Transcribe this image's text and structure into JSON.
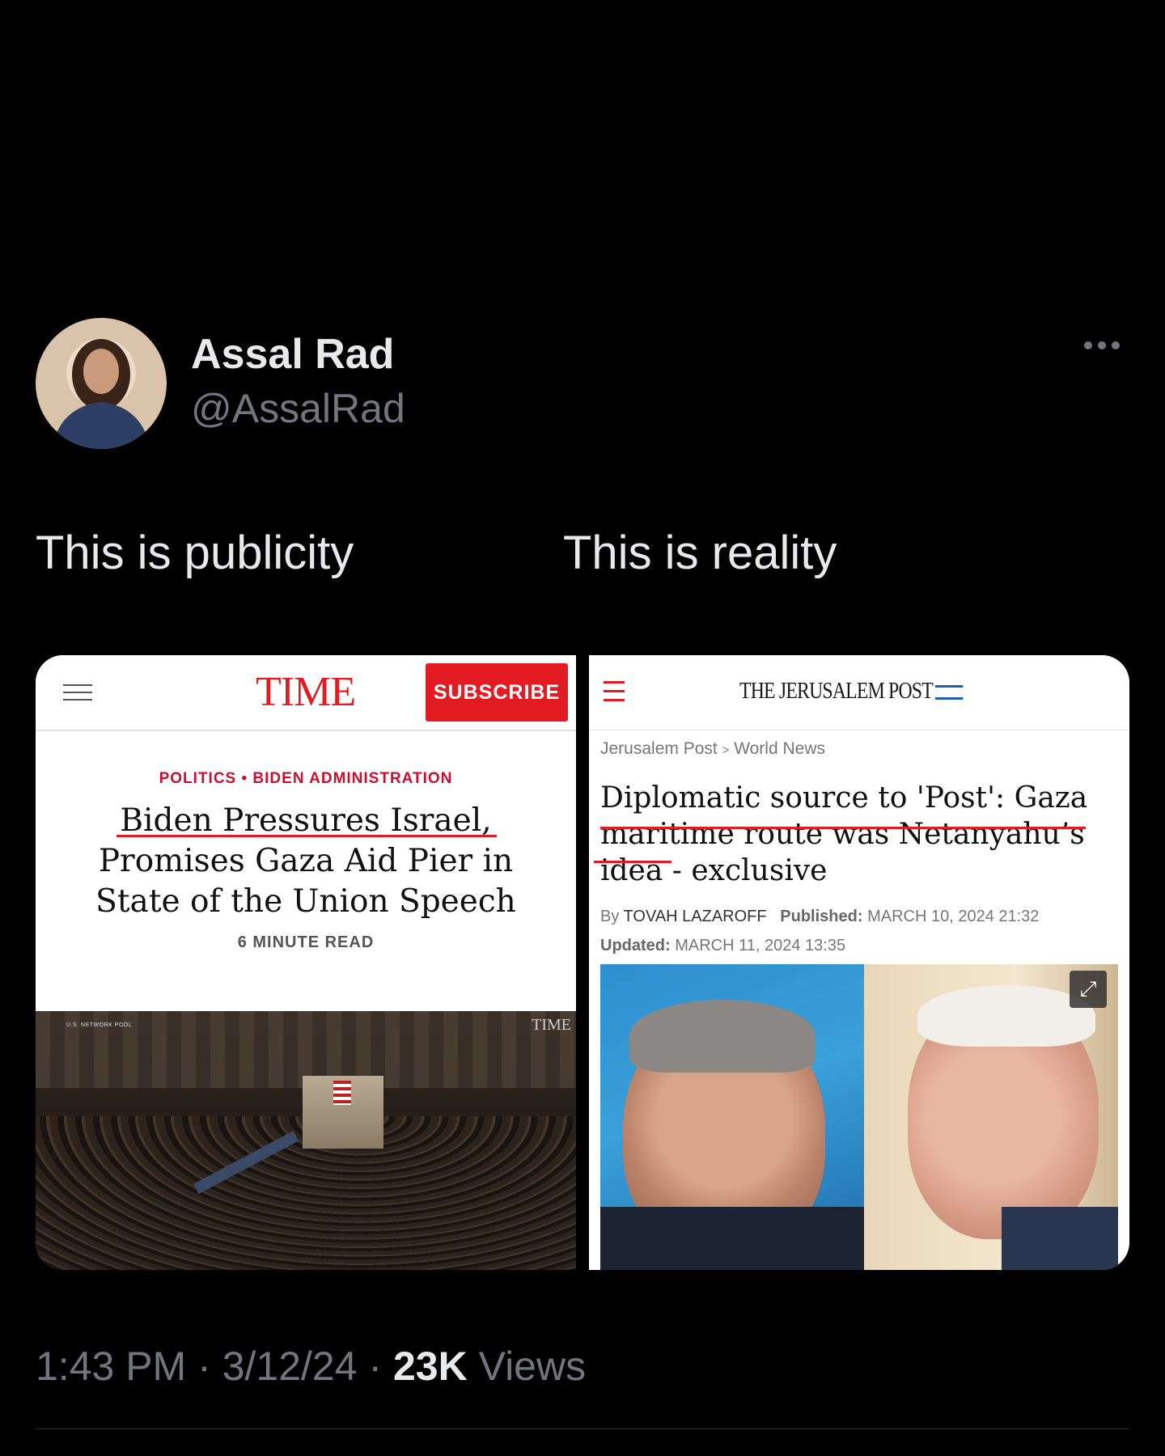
{
  "tweet": {
    "author_name": "Assal Rad",
    "author_handle": "@AssalRad",
    "more_icon": "ellipsis-icon",
    "text_left": "This is publicity",
    "text_right": "This is reality",
    "time": "1:43 PM",
    "date": "3/12/24",
    "views_count": "23K",
    "views_label": "Views",
    "separator": "·"
  },
  "time_article": {
    "logo": "TIME",
    "subscribe_label": "SUBSCRIBE",
    "kicker": "POLITICS • BIDEN ADMINISTRATION",
    "headline": "Biden Pressures Israel, Promises Gaza Aid Pier in State of the Union Speech",
    "read_time": "6 MINUTE READ",
    "photo_watermark": "TIME",
    "photo_credit": "U.S. NETWORK POOL",
    "accent_color": "#e31b23"
  },
  "jpost_article": {
    "logo": "THE JERUSALEM POST",
    "breadcrumb_home": "Jerusalem Post",
    "breadcrumb_sep": ">",
    "breadcrumb_section": "World News",
    "headline": "Diplomatic source to 'Post': Gaza maritime route was Netanyahu’s idea - exclusive",
    "by_label": "By",
    "author": "TOVAH LAZAROFF",
    "published_label": "Published:",
    "published_date": "MARCH 10, 2024 21:32",
    "updated_label": "Updated:",
    "updated_date": "MARCH 11, 2024 13:35",
    "expand_icon": "expand-icon"
  }
}
